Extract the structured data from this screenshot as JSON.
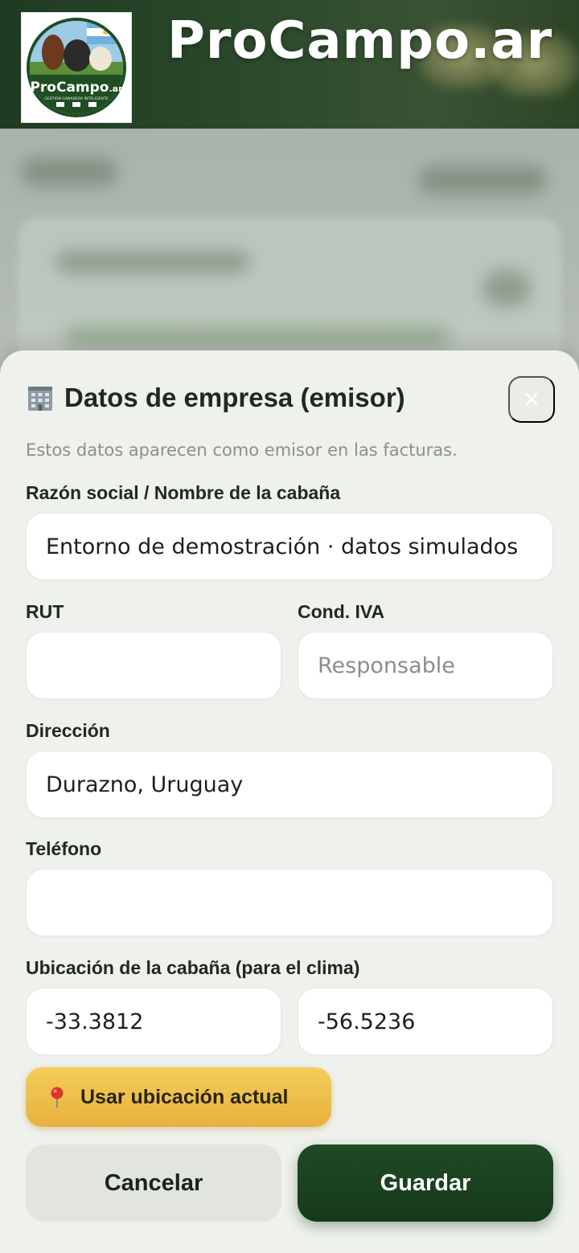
{
  "app": {
    "brand": "ProCampo.ar",
    "logo_text": "ProCampo",
    "logo_suffix": ".ar",
    "logo_tagline": "GESTIÓN GANADERA INTELIGENTE"
  },
  "modal": {
    "title_icon": "office-building-icon",
    "title": "Datos de empresa (emisor)",
    "close_icon": "close-icon",
    "subtitle": "Estos datos aparecen como emisor en las facturas.",
    "fields": {
      "razon_social": {
        "label": "Razón social / Nombre de la cabaña",
        "value": "Entorno de demostración · datos simulados"
      },
      "rut": {
        "label": "RUT",
        "value": ""
      },
      "cond_iva": {
        "label": "Cond. IVA",
        "value": "",
        "placeholder": "Responsable"
      },
      "direccion": {
        "label": "Dirección",
        "value": "Durazno, Uruguay"
      },
      "telefono": {
        "label": "Teléfono",
        "value": ""
      },
      "ubicacion": {
        "label": "Ubicación de la cabaña (para el clima)",
        "lat": "-33.3812",
        "lon": "-56.5236"
      }
    },
    "location_button": {
      "icon": "map-pin-icon",
      "label": "Usar ubicación actual"
    },
    "cancel_label": "Cancelar",
    "save_label": "Guardar"
  },
  "colors": {
    "primary": "#1a4220",
    "accent": "#ebb944",
    "sheet_bg": "#eef1ec"
  }
}
